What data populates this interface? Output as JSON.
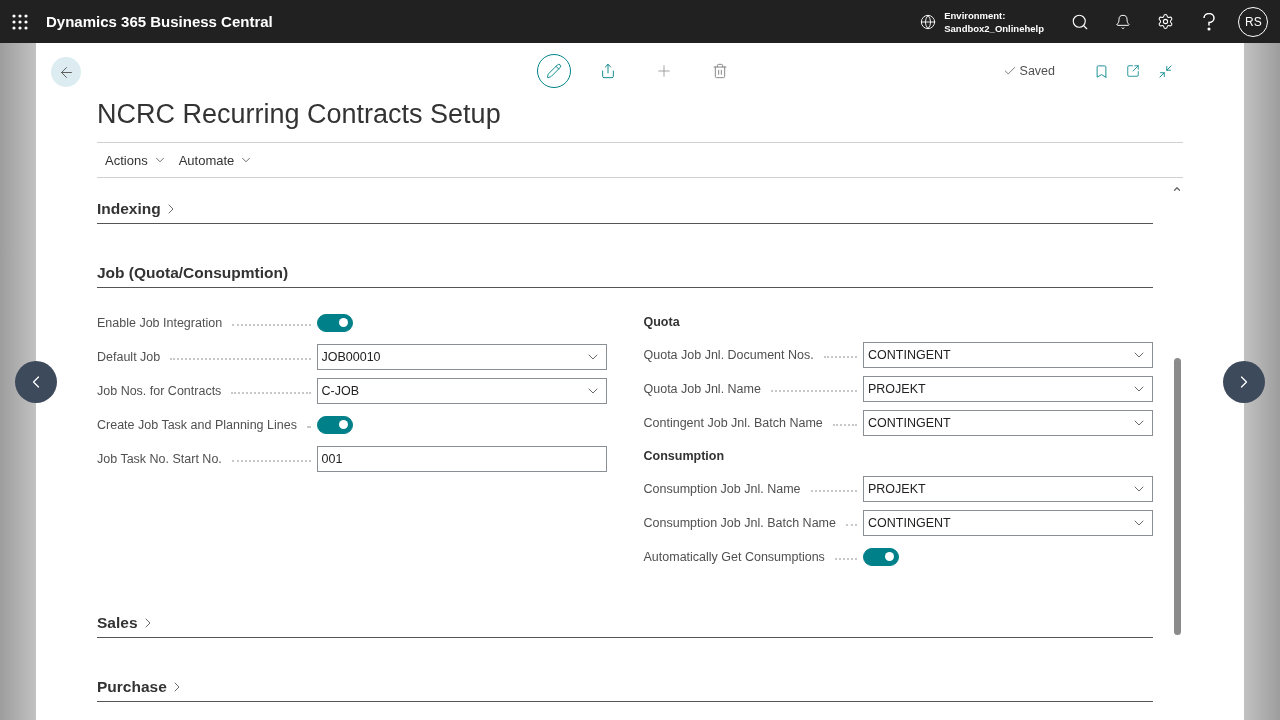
{
  "top_bar": {
    "app_title": "Dynamics 365 Business Central",
    "environment_label": "Environment:",
    "environment_name": "Sandbox2_Onlinehelp",
    "user_initials": "RS"
  },
  "page": {
    "status": "Saved",
    "title": "NCRC Recurring Contracts Setup",
    "menu": [
      {
        "label": "Actions"
      },
      {
        "label": "Automate"
      }
    ]
  },
  "sections": [
    {
      "title": "Indexing",
      "expanded": false
    },
    {
      "title": "Job (Quota/Consupmtion)",
      "expanded": true,
      "left_fields": [
        {
          "kind": "toggle",
          "label": "Enable Job Integration",
          "on": true
        },
        {
          "kind": "select",
          "label": "Default Job",
          "value": "JOB00010"
        },
        {
          "kind": "select",
          "label": "Job Nos. for Contracts",
          "value": "C-JOB"
        },
        {
          "kind": "toggle",
          "label": "Create Job Task and Planning Lines",
          "on": true
        },
        {
          "kind": "text",
          "label": "Job Task No. Start No.",
          "value": "001"
        }
      ],
      "right_groups": [
        {
          "heading": "Quota",
          "fields": [
            {
              "kind": "select",
              "label": "Quota Job Jnl. Document Nos.",
              "value": "CONTINGENT"
            },
            {
              "kind": "select",
              "label": "Quota Job Jnl. Name",
              "value": "PROJEKT"
            },
            {
              "kind": "select",
              "label": "Contingent Job Jnl. Batch Name",
              "value": "CONTINGENT"
            }
          ]
        },
        {
          "heading": "Consumption",
          "fields": [
            {
              "kind": "select",
              "label": "Consumption Job Jnl. Name",
              "value": "PROJEKT"
            },
            {
              "kind": "select",
              "label": "Consumption Job Jnl. Batch Name",
              "value": "CONTINGENT"
            },
            {
              "kind": "toggle",
              "label": "Automatically Get Consumptions",
              "on": true
            }
          ]
        }
      ]
    },
    {
      "title": "Sales",
      "expanded": false
    },
    {
      "title": "Purchase",
      "expanded": false
    }
  ]
}
